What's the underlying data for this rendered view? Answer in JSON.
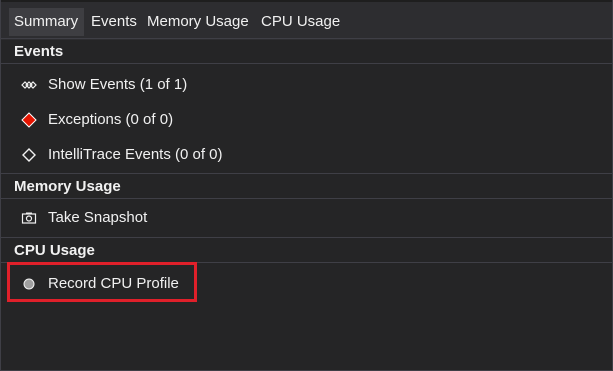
{
  "tabs": {
    "summary": "Summary",
    "events": "Events",
    "memory_usage": "Memory Usage",
    "cpu_usage": "CPU Usage",
    "active": "Summary"
  },
  "events_section": {
    "title": "Events",
    "items": [
      {
        "label": "Show Events (1 of 1)",
        "icon": "show-events-icon"
      },
      {
        "label": "Exceptions (0 of 0)",
        "icon": "exception-diamond-icon"
      },
      {
        "label": "IntelliTrace Events (0 of 0)",
        "icon": "intellitrace-diamond-icon"
      }
    ]
  },
  "memory_section": {
    "title": "Memory Usage",
    "items": [
      {
        "label": "Take Snapshot",
        "icon": "camera-icon"
      }
    ]
  },
  "cpu_section": {
    "title": "CPU Usage",
    "items": [
      {
        "label": "Record CPU Profile",
        "icon": "record-circle-icon"
      }
    ]
  },
  "colors": {
    "background": "#252526",
    "tab_active": "#3e3e42",
    "exception_red": "#e51400",
    "highlight_red": "#e0202a",
    "text": "#f1f1f1"
  }
}
